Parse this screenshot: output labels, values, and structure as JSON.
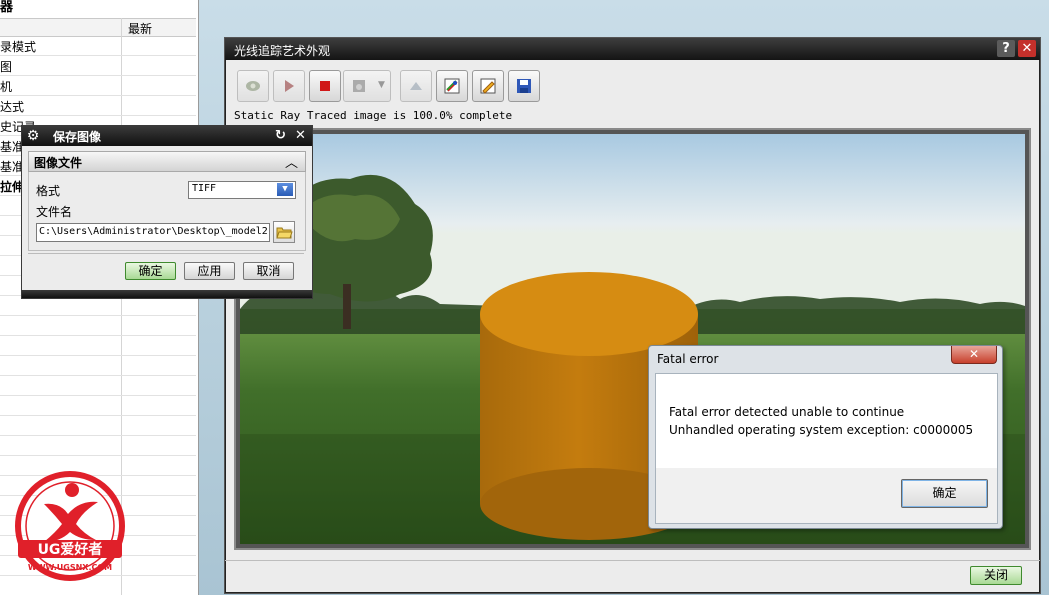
{
  "navigator": {
    "title": "器",
    "column_header": "最新",
    "rows": [
      "录模式",
      "图",
      "机",
      "达式",
      "史记录",
      "基准坐",
      "基准坐",
      "拉伸"
    ]
  },
  "raytrace_window": {
    "title": "光线追踪艺术外观",
    "help_label": "?",
    "close_x": "✕",
    "toolbar": [
      {
        "name": "lens-icon",
        "enabled": false
      },
      {
        "name": "play-icon",
        "enabled": false
      },
      {
        "name": "stop-icon",
        "enabled": true
      },
      {
        "name": "display-mode-icon",
        "enabled": false
      },
      {
        "name": "region-icon",
        "enabled": false
      },
      {
        "name": "render-styles-icon",
        "enabled": true
      },
      {
        "name": "edit-pencil-icon",
        "enabled": true
      },
      {
        "name": "save-disk-icon",
        "enabled": true
      }
    ],
    "status": "Static Ray Traced image is 100.0% complete",
    "close_button": "关闭"
  },
  "save_dialog": {
    "title": "保存图像",
    "section": "图像文件",
    "format_label": "格式",
    "format_value": "TIFF",
    "filename_label": "文件名",
    "filename_value": "C:\\Users\\Administrator\\Desktop\\_model2",
    "ok_label": "确定",
    "apply_label": "应用",
    "cancel_label": "取消"
  },
  "fatal_dialog": {
    "title": "Fatal error",
    "close_x": "✕",
    "line1": "Fatal error detected unable to continue",
    "line2": "Unhandled operating system exception: c0000005",
    "ok_label": "确定"
  },
  "logo": {
    "brand": "UG爱好者",
    "url": "WWW.UGSNX.COM"
  },
  "colors": {
    "cylinder": "#d68c12",
    "title_bar": "#1c1c1c",
    "error_close": "#c7402c",
    "logo_red": "#e0202a"
  }
}
